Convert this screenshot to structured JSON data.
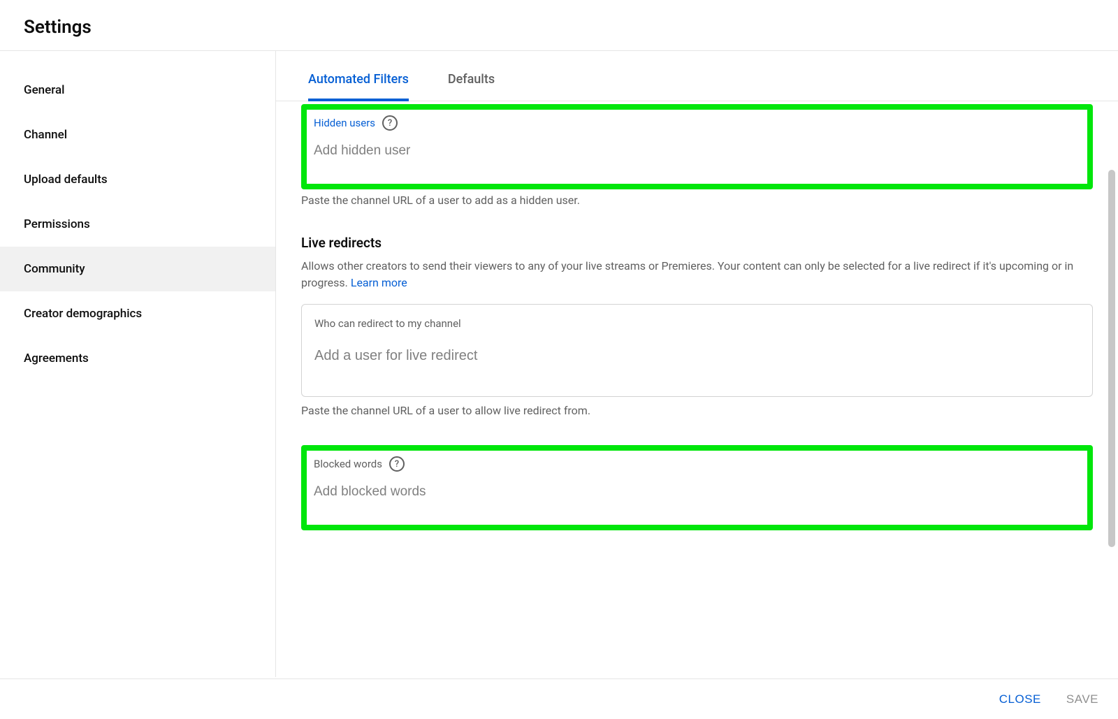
{
  "header": {
    "title": "Settings"
  },
  "sidebar": {
    "items": [
      {
        "label": "General"
      },
      {
        "label": "Channel"
      },
      {
        "label": "Upload defaults"
      },
      {
        "label": "Permissions"
      },
      {
        "label": "Community",
        "active": true
      },
      {
        "label": "Creator demographics"
      },
      {
        "label": "Agreements"
      }
    ]
  },
  "tabs": [
    {
      "label": "Automated Filters",
      "active": true
    },
    {
      "label": "Defaults"
    }
  ],
  "hidden_users": {
    "label": "Hidden users",
    "placeholder": "Add hidden user",
    "helper": "Paste the channel URL of a user to add as a hidden user."
  },
  "live_redirects": {
    "title": "Live redirects",
    "description": "Allows other creators to send their viewers to any of your live streams or Premieres. Your content can only be selected for a live redirect if it's upcoming or in progress. ",
    "learn_more": "Learn more",
    "inner_label": "Who can redirect to my channel",
    "placeholder": "Add a user for live redirect",
    "helper": "Paste the channel URL of a user to allow live redirect from."
  },
  "blocked_words": {
    "label": "Blocked words",
    "placeholder": "Add blocked words"
  },
  "footer": {
    "close": "CLOSE",
    "save": "SAVE"
  }
}
